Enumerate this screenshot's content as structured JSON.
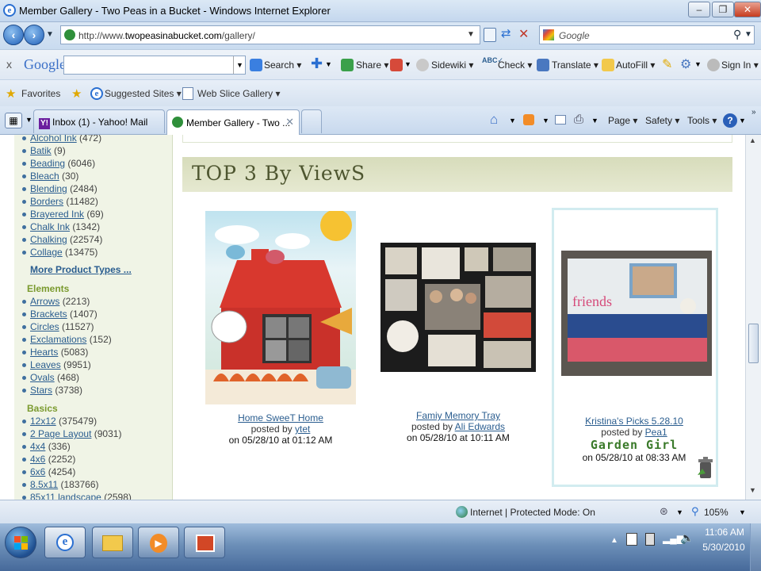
{
  "window": {
    "title": "Member Gallery - Two Peas in a Bucket - Windows Internet Explorer",
    "minimize": "–",
    "restore": "❐",
    "close": "✕"
  },
  "address_bar": {
    "url_prefix": "http://www.",
    "url_domain": "twopeasinabucket.com",
    "url_path": "/gallery/",
    "search_placeholder": "Google"
  },
  "google_toolbar": {
    "close": "x",
    "logo": "Google",
    "search": "Search ▾",
    "share": "Share ▾",
    "sidewiki": "Sidewiki ▾",
    "check": "Check ▾",
    "translate": "Translate ▾",
    "autofill": "AutoFill ▾",
    "signin": "Sign In ▾"
  },
  "favorites_bar": {
    "favorites": "Favorites",
    "suggested_sites": "Suggested Sites ▾",
    "web_slice_gallery": "Web Slice Gallery ▾"
  },
  "tabs": [
    {
      "label": "Inbox (1) - Yahoo! Mail"
    },
    {
      "label": "Member Gallery - Two ..."
    }
  ],
  "command_bar": {
    "page": "Page ▾",
    "safety": "Safety ▾",
    "tools": "Tools ▾"
  },
  "sidebar": {
    "product_items": [
      {
        "label": "Alcohol Ink",
        "count": "(472)"
      },
      {
        "label": "Batik",
        "count": "(9)"
      },
      {
        "label": "Beading",
        "count": "(6046)"
      },
      {
        "label": "Bleach",
        "count": "(30)"
      },
      {
        "label": "Blending",
        "count": "(2484)"
      },
      {
        "label": "Borders",
        "count": "(11482)"
      },
      {
        "label": "Brayered Ink",
        "count": "(69)"
      },
      {
        "label": "Chalk Ink",
        "count": "(1342)"
      },
      {
        "label": "Chalking",
        "count": "(22574)"
      },
      {
        "label": "Collage",
        "count": "(13475)"
      }
    ],
    "more_product_types": "More Product Types ...",
    "elements_heading": "Elements",
    "element_items": [
      {
        "label": "Arrows",
        "count": "(2213)"
      },
      {
        "label": "Brackets",
        "count": "(1407)"
      },
      {
        "label": "Circles",
        "count": "(11527)"
      },
      {
        "label": "Exclamations",
        "count": "(152)"
      },
      {
        "label": "Hearts",
        "count": "(5083)"
      },
      {
        "label": "Leaves",
        "count": "(9951)"
      },
      {
        "label": "Ovals",
        "count": "(468)"
      },
      {
        "label": "Stars",
        "count": "(3738)"
      }
    ],
    "basics_heading": "Basics",
    "basic_items": [
      {
        "label": "12x12",
        "count": "(375479)"
      },
      {
        "label": "2 Page Layout",
        "count": "(9031)"
      },
      {
        "label": "4x4",
        "count": "(336)"
      },
      {
        "label": "4x6",
        "count": "(2252)"
      },
      {
        "label": "6x6",
        "count": "(4254)"
      },
      {
        "label": "8.5x11",
        "count": "(183766)"
      },
      {
        "label": "85x11 landscape",
        "count": "(2598)"
      }
    ]
  },
  "main": {
    "heading": "TOP 3 By ViewS",
    "items": [
      {
        "title": "Home SweeT Home",
        "posted_by": "posted by",
        "user": "ytet",
        "date": "on 05/28/10 at 01:12 AM"
      },
      {
        "title": "Famiy Memory Tray",
        "posted_by": "posted by",
        "user": "Ali Edwards",
        "date": "on 05/28/10 at 10:11 AM"
      },
      {
        "title": "Kristina's Picks 5.28.10",
        "posted_by": "posted by",
        "user": "Pea1",
        "badge": "Garden Girl",
        "date": "on 05/28/10 at 08:33 AM"
      }
    ]
  },
  "status_bar": {
    "zone": "Internet | Protected Mode: On",
    "zoom": "105%"
  },
  "taskbar": {
    "time": "11:06 AM",
    "date": "5/30/2010"
  },
  "colors": {
    "sidebar_bg": "#f0f4e6",
    "heading_green": "#7a9a2e",
    "link_blue": "#2a5d8f",
    "header_band": "#d7dcbb"
  }
}
